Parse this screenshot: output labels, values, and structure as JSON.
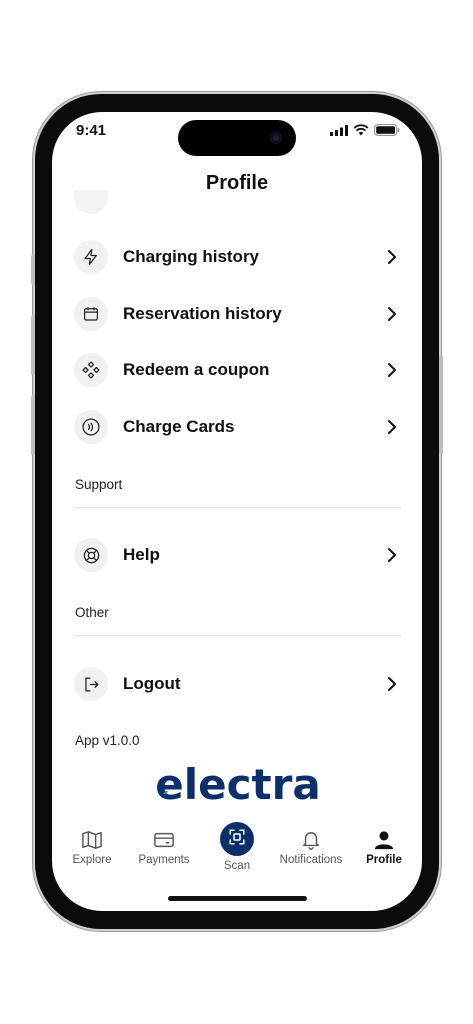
{
  "status": {
    "time": "9:41"
  },
  "header": {
    "title": "Profile"
  },
  "menu": {
    "items": [
      {
        "label": "Charging history",
        "icon": "lightning-icon"
      },
      {
        "label": "Reservation history",
        "icon": "calendar-icon"
      },
      {
        "label": "Redeem a coupon",
        "icon": "coupon-icon"
      },
      {
        "label": "Charge Cards",
        "icon": "contactless-card-icon"
      }
    ],
    "support_label": "Support",
    "support_items": [
      {
        "label": "Help",
        "icon": "lifebuoy-icon"
      }
    ],
    "other_label": "Other",
    "other_items": [
      {
        "label": "Logout",
        "icon": "logout-icon"
      }
    ],
    "version": "App v1.0.0"
  },
  "brand": {
    "name": "electra",
    "primary_color": "#0b2f6b",
    "accent_color": "#3a7bd5"
  },
  "tabs": [
    {
      "label": "Explore",
      "icon": "map-icon"
    },
    {
      "label": "Payments",
      "icon": "card-icon"
    },
    {
      "label": "Scan",
      "icon": "scan-icon"
    },
    {
      "label": "Notifications",
      "icon": "bell-icon"
    },
    {
      "label": "Profile",
      "icon": "user-icon",
      "active": true
    }
  ]
}
